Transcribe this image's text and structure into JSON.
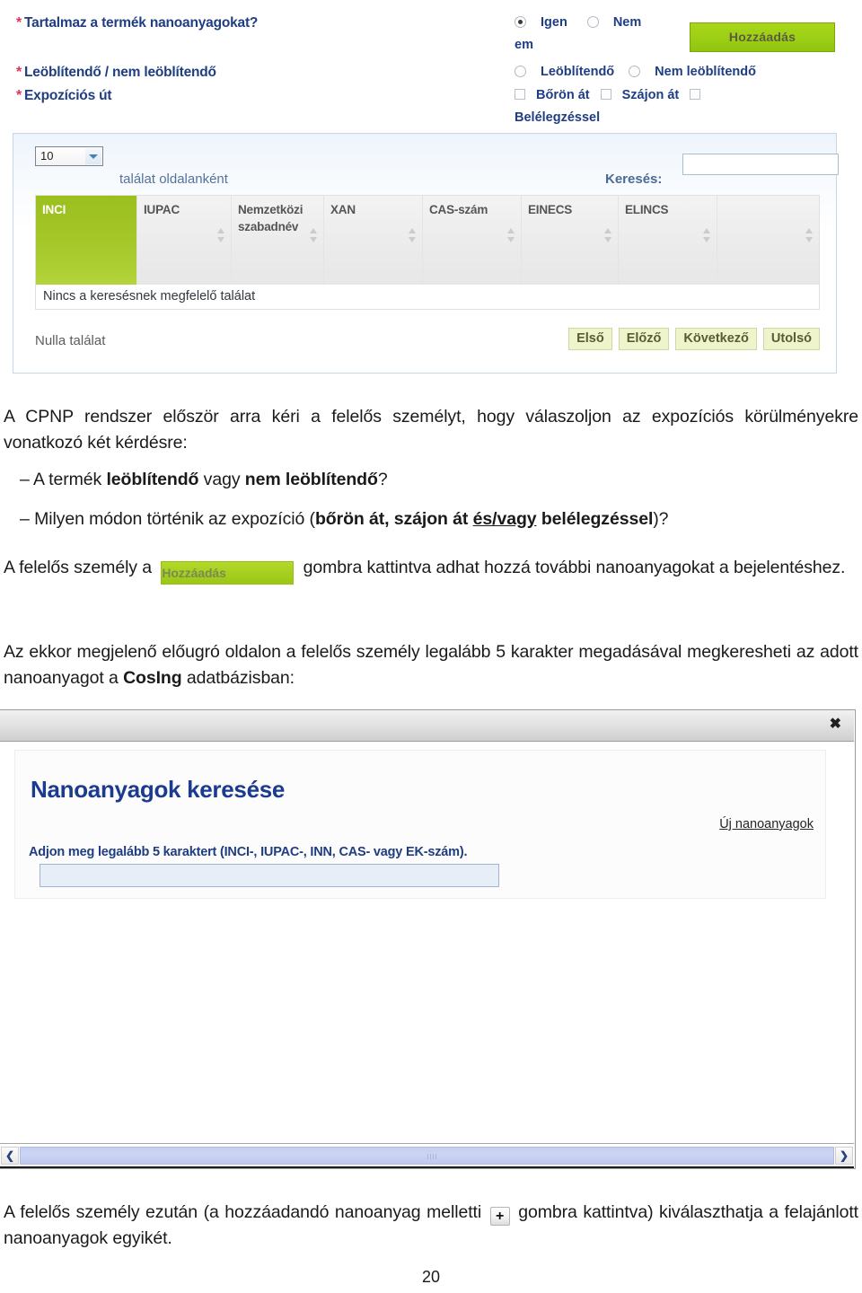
{
  "top_form": {
    "labels": [
      {
        "required_marker": "*",
        "text": "Tartalmaz a termék nanoanyagokat?"
      },
      {
        "required_marker": "*",
        "text": "Leöblítendő / nem leöblítendő"
      },
      {
        "required_marker": "*",
        "text": "Expozíciós út"
      }
    ],
    "nano_question": {
      "option_yes": "Igen",
      "option_no": "Nem",
      "option_yes_selected": true,
      "option_no_selected": false,
      "wrapped_fragment": "em"
    },
    "rinse_question": {
      "option_rinse_off": "Leöblítendő",
      "option_leave_on": "Nem leöblítendő",
      "option_rinse_off_selected": false,
      "option_leave_on_selected": false
    },
    "exposure_route": {
      "option_skin": "Bőrön át",
      "option_oral": "Szájon át",
      "option_inhalation": "Belélegzéssel",
      "option_skin_checked": false,
      "option_oral_checked": false,
      "option_inhalation_checked": false
    },
    "add_button_label": "Hozzáadás"
  },
  "result_table": {
    "page_length_value": "10",
    "page_length_caption": "találat oldalanként",
    "search_label": "Keresés:",
    "search_value": "",
    "search_placeholder": "",
    "columns": [
      "INCI",
      "IUPAC",
      "Nemzetközi szabadnév",
      "XAN",
      "CAS-szám",
      "EINECS",
      "ELINCS",
      ""
    ],
    "active_column": "INCI",
    "empty_message": "Nincs a keresésnek megfelelő találat",
    "footer_info": "Nulla találat",
    "pager": [
      "Első",
      "Előző",
      "Következő",
      "Utolsó"
    ]
  },
  "document": {
    "paragraph_1": "A CPNP rendszer először arra kéri a felelős személyt, hogy válaszoljon az expozíciós körülményekre vonatkozó két kérdésre:",
    "bullet_1": {
      "prefix": "– A termék ",
      "bold_1": "leöblítendő",
      "middle": " vagy ",
      "bold_2": "nem leöblítendő",
      "suffix": "?"
    },
    "bullet_2": {
      "prefix": "– Milyen módon történik az expozíció (",
      "bold_1": "bőrön át, szájon át ",
      "underline_bold": "és/vagy",
      "bold_2": " belélegzéssel",
      "suffix": ")?"
    },
    "paragraph_with_button": {
      "before": "A felelős személy a",
      "button_label": "Hozzáadás",
      "after": "gombra kattintva adhat hozzá további nanoanyagokat a bejelentéshez."
    },
    "paragraph_2": {
      "before": "Az ekkor megjelenő előugró oldalon a felelős személy legalább 5 karakter megadásával megkeresheti az adott nanoanyagot a ",
      "bold": "CosIng",
      "after": " adatbázisban:"
    },
    "paragraph_3": {
      "before": "A felelős személy ezután (a hozzáadandó nanoanyag melletti",
      "plus_glyph": "+",
      "after": "gombra kattintva) kiválaszthatja a felajánlott nanoanyagok egyikét."
    },
    "page_number": "20"
  },
  "popup_dialog": {
    "close_icon_glyph": "✖",
    "title": "Nanoanyagok keresése",
    "new_materials_link": "Új nanoanyagok",
    "hint": "Adjon meg legalább 5 karaktert (INCI-, IUPAC-, INN, CAS- vagy EK-szám).",
    "search_value": "",
    "search_placeholder": "",
    "scrollbar": {
      "left_arrow": "❮",
      "right_arrow": "❯"
    }
  },
  "colors": {
    "label_blue": "#1f3d82",
    "required_red": "#e0315b",
    "accent_green": "#9ed016",
    "title_blue": "#1b3b8f",
    "pager_bg": "#eff4cd"
  }
}
